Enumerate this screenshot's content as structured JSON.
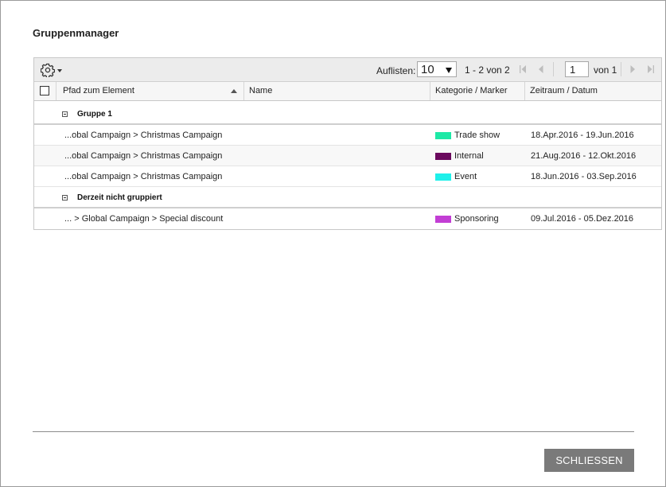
{
  "dialog": {
    "title": "Gruppenmanager",
    "close_label": "SCHLIESSEN"
  },
  "toolbar": {
    "settings_icon": "gear-icon",
    "page_size_label": "Auflisten:",
    "page_size": "10",
    "range_text": "1 - 2 von 2",
    "current_page": "1",
    "total_pages_text": "von 1"
  },
  "columns": {
    "path": "Pfad zum Element",
    "name": "Name",
    "category": "Kategorie / Marker",
    "period": "Zeitraum / Datum"
  },
  "groups": [
    {
      "label": "Gruppe 1",
      "rows": [
        {
          "path": "...obal Campaign > Christmas Campaign",
          "name": "",
          "category": "Trade show",
          "color": "#1de9a6",
          "period": "18.Apr.2016 - 19.Jun.2016"
        },
        {
          "path": "...obal Campaign > Christmas Campaign",
          "name": "",
          "category": "Internal",
          "color": "#6b0a5e",
          "period": "21.Aug.2016 - 12.Okt.2016"
        },
        {
          "path": "...obal Campaign > Christmas Campaign",
          "name": "",
          "category": "Event",
          "color": "#1ef0ea",
          "period": "18.Jun.2016 - 03.Sep.2016"
        }
      ]
    },
    {
      "label": "Derzeit nicht gruppiert",
      "rows": [
        {
          "path": "... > Global Campaign > Special discount",
          "name": "",
          "category": "Sponsoring",
          "color": "#c23ed4",
          "period": "09.Jul.2016 - 05.Dez.2016"
        }
      ]
    }
  ]
}
